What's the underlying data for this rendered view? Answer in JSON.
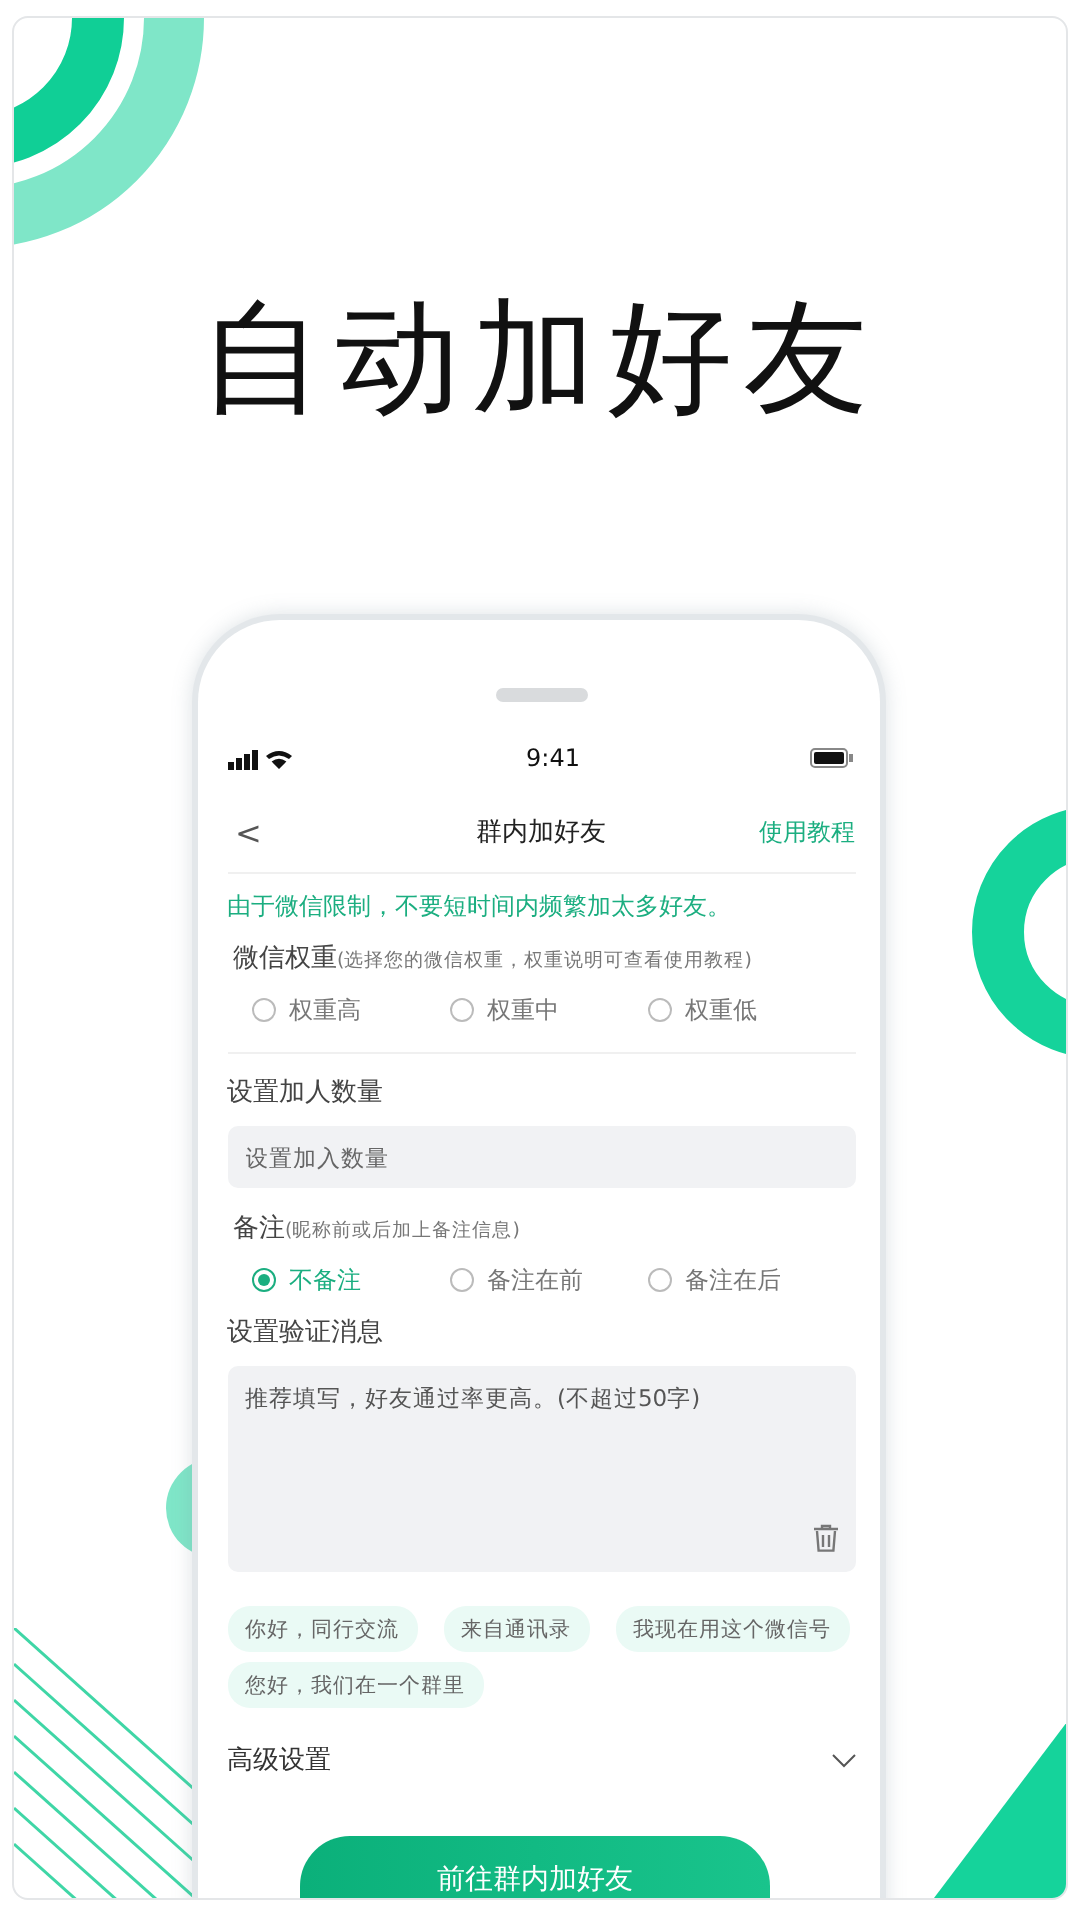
{
  "headline": "自动加好友",
  "status_bar": {
    "time": "9:41"
  },
  "nav": {
    "back": "<",
    "title": "群内加好友",
    "action": "使用教程"
  },
  "notice": "由于微信限制，不要短时间内频繁加太多好友。",
  "weight": {
    "label": "微信权重",
    "hint": "(选择您的微信权重，权重说明可查看使用教程)",
    "options": [
      {
        "label": "权重高",
        "selected": false
      },
      {
        "label": "权重中",
        "selected": false
      },
      {
        "label": "权重低",
        "selected": false
      }
    ]
  },
  "count": {
    "label": "设置加人数量",
    "placeholder": "设置加入数量"
  },
  "remark": {
    "label": "备注",
    "hint": "(昵称前或后加上备注信息)",
    "options": [
      {
        "label": "不备注",
        "selected": true
      },
      {
        "label": "备注在前",
        "selected": false
      },
      {
        "label": "备注在后",
        "selected": false
      }
    ]
  },
  "message": {
    "label": "设置验证消息",
    "placeholder": "推荐填写，好友通过率更高。(不超过50字)"
  },
  "chips": [
    "你好，同行交流",
    "来自通讯录",
    "我现在用这个微信号",
    "您好，我们在一个群里"
  ],
  "advanced": {
    "label": "高级设置",
    "expanded": false
  },
  "submit": "前往群内加好友"
}
